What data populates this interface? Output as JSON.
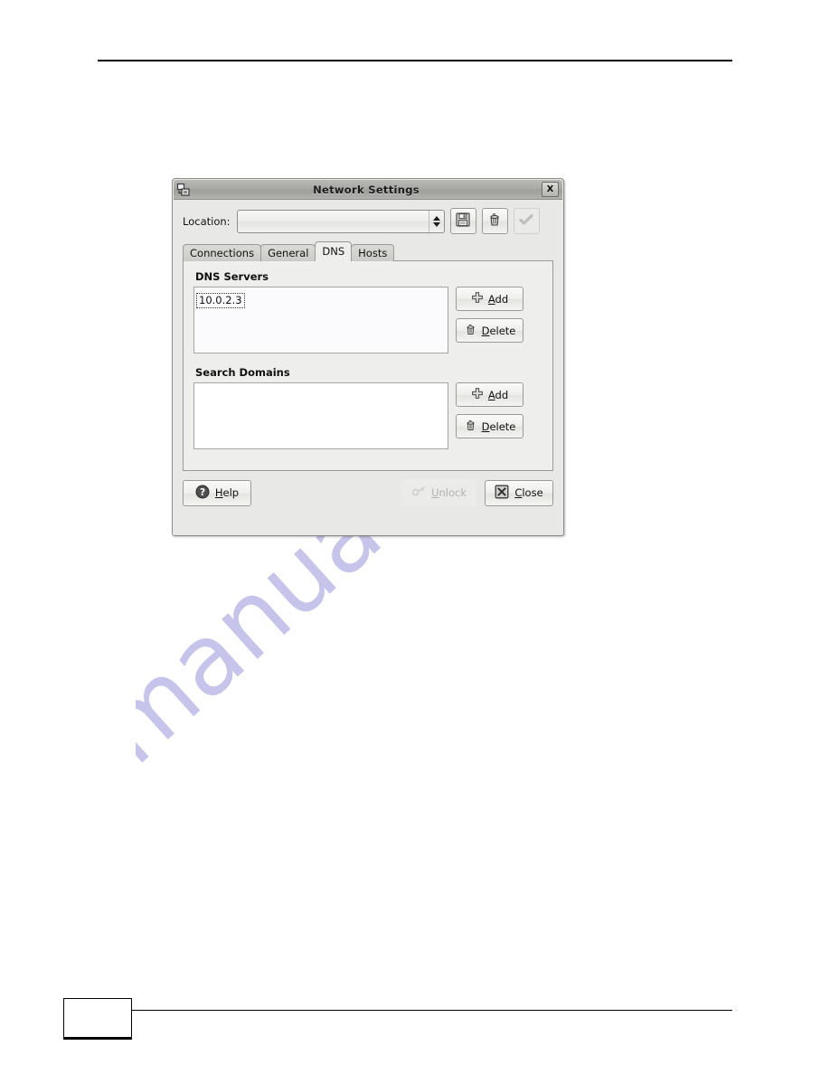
{
  "page": {
    "watermark_text": "manualshive.com",
    "watermark_color": "#c6c4ea"
  },
  "dialog": {
    "title": "Network Settings",
    "window_icon": "network-settings-icon",
    "close_button_label": "X",
    "location": {
      "label": "Location:",
      "value": "",
      "spinner_icon": "up-down-arrows-icon"
    },
    "toolbar": [
      {
        "name": "save-location-button",
        "icon": "floppy-disk-icon",
        "enabled": true
      },
      {
        "name": "delete-location-button",
        "icon": "trash-can-icon",
        "enabled": true
      },
      {
        "name": "apply-button",
        "icon": "checkmark-icon",
        "enabled": false
      }
    ],
    "tabs": [
      {
        "label": "Connections",
        "active": false
      },
      {
        "label": "General",
        "active": false
      },
      {
        "label": "DNS",
        "active": true
      },
      {
        "label": "Hosts",
        "active": false
      }
    ],
    "dns_tab": {
      "dns_servers": {
        "title": "DNS Servers",
        "items": [
          "10.0.2.3"
        ],
        "add_label": "Add",
        "add_accel": "A",
        "delete_label": "Delete",
        "delete_accel": "D",
        "add_icon": "plus-icon",
        "delete_icon": "trash-can-icon"
      },
      "search_domains": {
        "title": "Search Domains",
        "items": [],
        "add_label": "Add",
        "add_accel": "A",
        "delete_label": "Delete",
        "delete_accel": "D",
        "add_icon": "plus-icon",
        "delete_icon": "trash-can-icon"
      }
    },
    "actions": {
      "help_label": "Help",
      "help_accel": "H",
      "help_icon": "question-mark-icon",
      "unlock_label": "Unlock",
      "unlock_accel": "U",
      "unlock_icon": "key-icon",
      "unlock_enabled": false,
      "close_label": "Close",
      "close_accel": "C",
      "close_icon": "x-box-icon"
    }
  }
}
